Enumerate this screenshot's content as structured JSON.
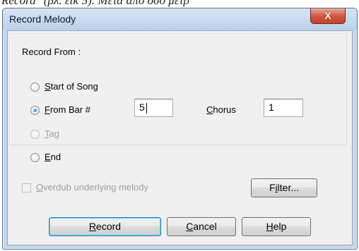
{
  "background_caption": "Record\" (βλ. εικ 5). Μετά από όσο μέτρ",
  "window": {
    "title": "Record Melody",
    "close_glyph": "X"
  },
  "record_from_label": "Record From :",
  "options": {
    "start_of_song": {
      "label_mnemonic": "S",
      "label_rest": "tart of Song",
      "checked": false,
      "enabled": true
    },
    "from_bar": {
      "label_mnemonic": "F",
      "label_rest": "rom Bar #",
      "checked": true,
      "enabled": true
    },
    "tag": {
      "label_mnemonic": "T",
      "label_rest": "ag",
      "checked": false,
      "enabled": false
    },
    "end": {
      "label_mnemonic": "E",
      "label_rest": "nd",
      "checked": false,
      "enabled": true
    }
  },
  "from_bar_value": "5",
  "chorus": {
    "label_mnemonic": "C",
    "label_rest": "horus",
    "value": "1"
  },
  "overdub": {
    "label_mnemonic": "O",
    "label_rest": "verdub underlying melody",
    "checked": false,
    "enabled": false
  },
  "buttons": {
    "filter": {
      "mnemonic": "i",
      "pre": "F",
      "post": "lter..."
    },
    "record": {
      "mnemonic": "R",
      "pre": "",
      "post": "ecord"
    },
    "cancel": {
      "mnemonic": "C",
      "pre": "",
      "post": "ancel"
    },
    "help": {
      "mnemonic": "H",
      "pre": "",
      "post": "elp"
    }
  }
}
